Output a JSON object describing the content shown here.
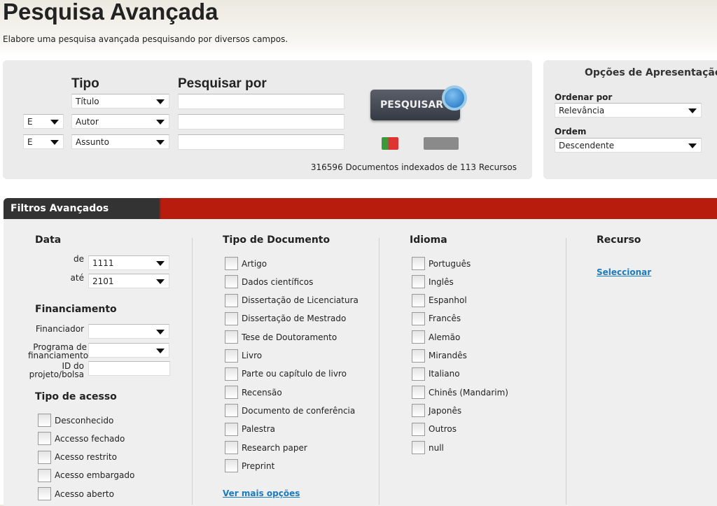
{
  "header": {
    "title": "Pesquisa Avançada",
    "subtitle": "Elabore uma pesquisa avançada pesquisando por diversos campos."
  },
  "search": {
    "tipo_label": "Tipo",
    "pesquisar_por_label": "Pesquisar por",
    "rows": [
      {
        "operator": null,
        "type": "Título",
        "value": ""
      },
      {
        "operator": "E",
        "type": "Autor",
        "value": ""
      },
      {
        "operator": "E",
        "type": "Assunto",
        "value": ""
      }
    ],
    "button": "PESQUISAR",
    "stats": "316596 Documentos indexados de 113 Recursos"
  },
  "options": {
    "title": "Opções de Apresentação",
    "ordenar_label": "Ordenar por",
    "ordenar_value": "Relevância",
    "ordem_label": "Ordem",
    "ordem_value": "Descendente"
  },
  "filters": {
    "title": "Filtros Avançados",
    "data": {
      "title": "Data",
      "de_label": "de",
      "de_value": "1111",
      "ate_label": "até",
      "ate_value": "2101"
    },
    "financiamento": {
      "title": "Financiamento",
      "financiador": "Financiador",
      "programa": "Programa de financiamento",
      "id": "ID do projeto/bolsa"
    },
    "acesso": {
      "title": "Tipo de acesso",
      "items": [
        "Desconhecido",
        "Accesso fechado",
        "Acesso restrito",
        "Acesso embargado",
        "Acesso aberto"
      ]
    },
    "tipo_documento": {
      "title": "Tipo de Documento",
      "items": [
        "Artigo",
        "Dados científicos",
        "Dissertação de Licenciatura",
        "Dissertação de Mestrado",
        "Tese de Doutoramento",
        "Livro",
        "Parte ou capítulo de livro",
        "Recensão",
        "Documento de conferência",
        "Palestra",
        "Research paper",
        "Preprint"
      ],
      "more": "Ver mais opções"
    },
    "idioma": {
      "title": "Idioma",
      "items": [
        "Português",
        "Inglês",
        "Espanhol",
        "Francês",
        "Alemão",
        "Mirandês",
        "Italiano",
        "Chinês (Mandarim)",
        "Japonês",
        "Outros",
        "null"
      ]
    },
    "recurso": {
      "title": "Recurso",
      "link": "Seleccionar"
    }
  },
  "colors": {
    "red": "#b81c0c",
    "dark": "#333333",
    "link": "#1a7bbf"
  }
}
